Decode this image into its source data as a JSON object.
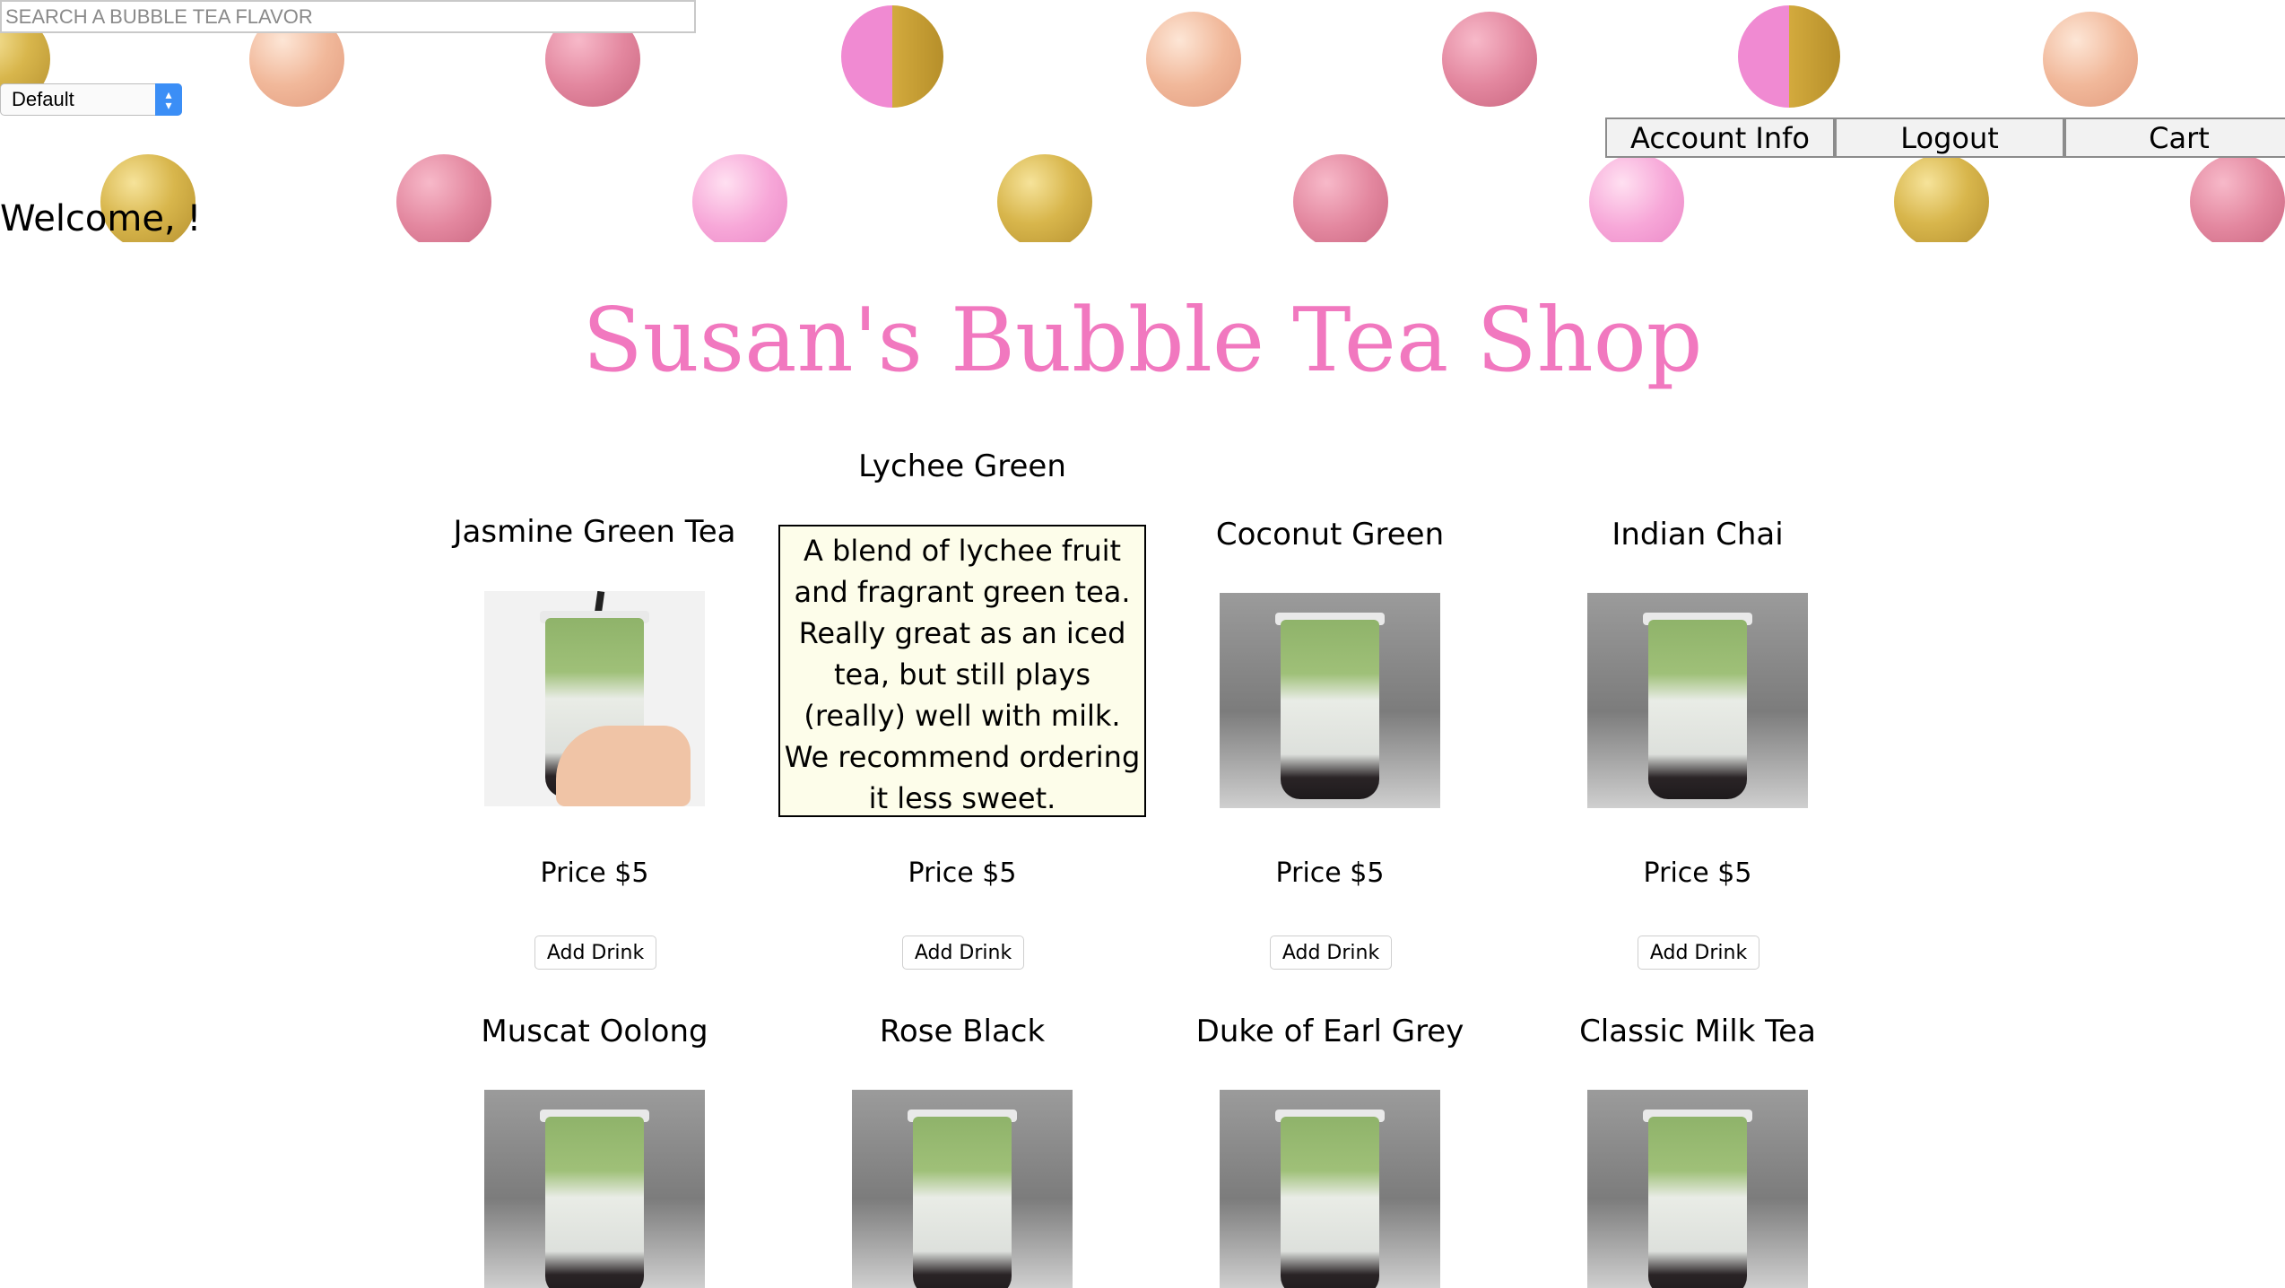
{
  "search": {
    "placeholder": "SEARCH A BUBBLE TEA FLAVOR"
  },
  "sort": {
    "selected": "Default"
  },
  "welcome": "Welcome, !",
  "nav": {
    "account": "Account Info",
    "logout": "Logout",
    "cart": "Cart"
  },
  "title": "Susan's Bubble Tea Shop",
  "colors": {
    "title": "#f178bf",
    "description_bg": "#fdfdea"
  },
  "products": [
    {
      "name": "Jasmine Green Tea",
      "price": "Price $5",
      "button": "Add Drink",
      "image": "hand-holding-cup"
    },
    {
      "name": "Lychee Green",
      "price": "Price $5",
      "button": "Add Drink",
      "description": "A blend of lychee fruit and fragrant green tea. Really great as an iced tea, but still plays (really) well with milk. We recommend ordering it less sweet."
    },
    {
      "name": "Coconut Green",
      "price": "Price $5",
      "button": "Add Drink",
      "image": "matcha-cup"
    },
    {
      "name": "Indian Chai",
      "price": "Price $5",
      "button": "Add Drink",
      "image": "matcha-cup"
    },
    {
      "name": "Muscat Oolong",
      "image": "matcha-cup"
    },
    {
      "name": "Rose Black",
      "image": "matcha-cup"
    },
    {
      "name": "Duke of Earl Grey",
      "image": "matcha-cup"
    },
    {
      "name": "Classic Milk Tea",
      "image": "matcha-cup"
    }
  ]
}
